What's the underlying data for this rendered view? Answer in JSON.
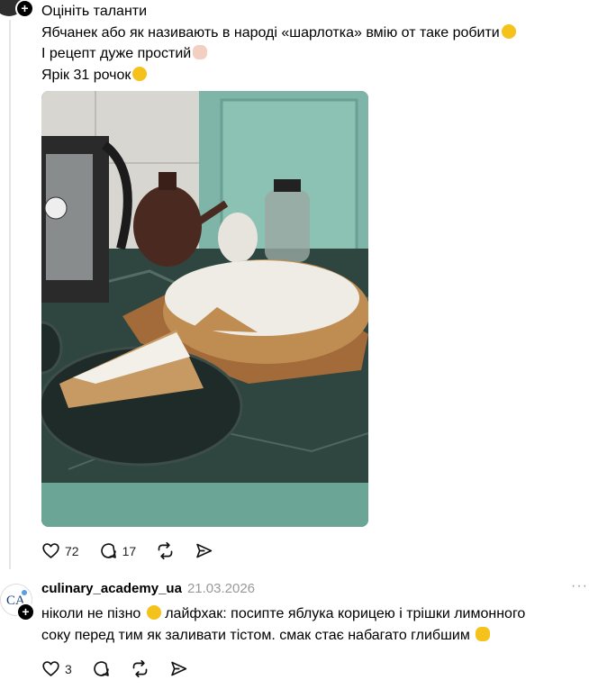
{
  "post": {
    "line1": "Оцініть таланти",
    "line2": "Ябчанек або як називають в народі «шарлотка» вмію от таке робити",
    "line3": "І рецепт дуже простий",
    "line4": "Ярік 31 рочок",
    "likes": "72",
    "comments": "17"
  },
  "comment": {
    "username": "culinary_academy_ua",
    "date": "21.03.2026",
    "text_line1_a": "ніколи не пізно",
    "text_line1_b": "лайфхак: посипте яблука корицею і трішки лимонного",
    "text_line2": "соку перед тим як заливати тістом. смак стає набагато глибшим",
    "likes": "3",
    "avatar_initials": "CA"
  },
  "icons": {
    "like": "heart-icon",
    "comment": "comment-bubble-icon",
    "repost": "repost-icon",
    "share": "share-icon",
    "more": "more-dots-icon",
    "follow": "plus-icon"
  },
  "colors": {
    "text": "#000000",
    "muted": "#999999",
    "thread_line": "#e5e5e5"
  }
}
